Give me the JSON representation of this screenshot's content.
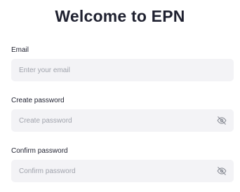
{
  "header": {
    "title": "Welcome to EPN"
  },
  "form": {
    "email": {
      "label": "Email",
      "placeholder": "Enter your email",
      "value": ""
    },
    "create_password": {
      "label": "Create password",
      "placeholder": "Create password",
      "value": "",
      "toggle_icon": "eye-off-icon"
    },
    "confirm_password": {
      "label": "Confirm password",
      "placeholder": "Confirm password",
      "value": "",
      "toggle_icon": "eye-off-icon"
    }
  },
  "colors": {
    "title_text": "#1f2130",
    "field_background": "#f3f3f6",
    "placeholder_text": "#9fa2ab",
    "icon": "#8e919a"
  }
}
